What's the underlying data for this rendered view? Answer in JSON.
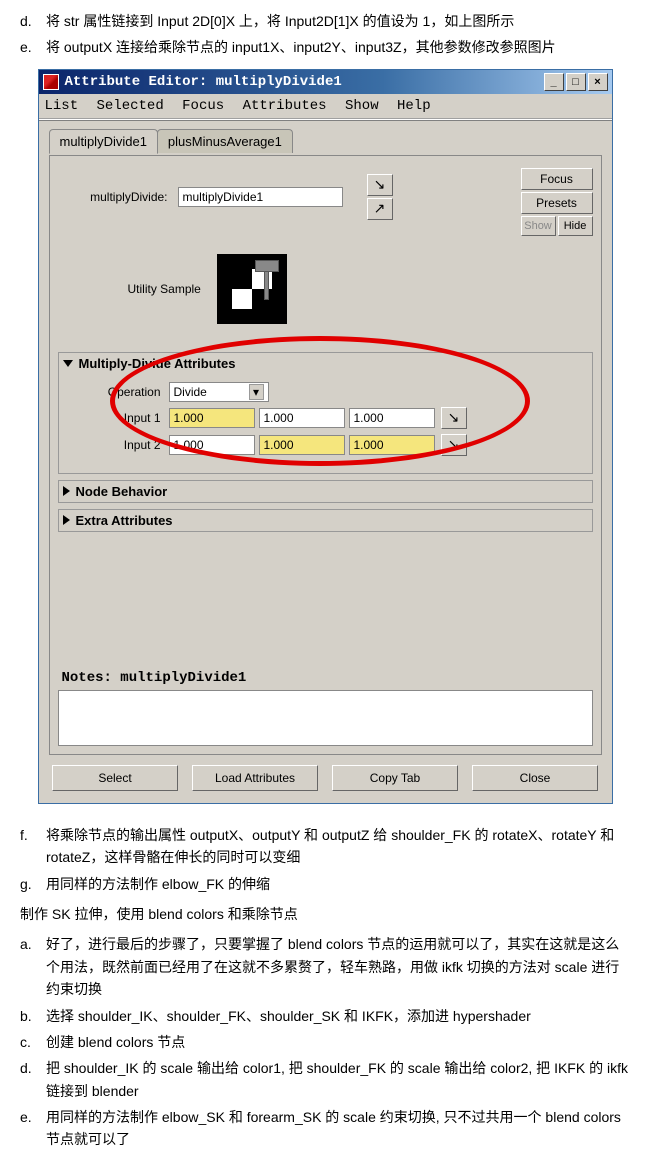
{
  "doc": {
    "d": {
      "bullet": "d.",
      "text": "将 str 属性链接到 Input 2D[0]X 上，将 Input2D[1]X 的值设为 1，如上图所示"
    },
    "e": {
      "bullet": "e.",
      "text": "将 outputX 连接给乘除节点的 input1X、input2Y、input3Z，其他参数修改参照图片"
    },
    "f": {
      "bullet": "f.",
      "text": "将乘除节点的输出属性 outputX、outputY 和 outputZ 给 shoulder_FK 的 rotateX、rotateY 和 rotateZ，这样骨骼在伸长的同时可以变细"
    },
    "g": {
      "bullet": "g.",
      "text": "用同样的方法制作 elbow_FK 的伸缩"
    },
    "section": "制作 SK 拉伸，使用 blend colors 和乘除节点",
    "a2": {
      "bullet": "a.",
      "text": "好了，进行最后的步骤了，只要掌握了 blend colors 节点的运用就可以了，其实在这就是这么个用法，既然前面已经用了在这就不多累赘了，轻车熟路，用做 ikfk 切换的方法对 scale 进行约束切换"
    },
    "b2": {
      "bullet": "b.",
      "text": "选择 shoulder_IK、shoulder_FK、shoulder_SK 和 IKFK，添加进 hypershader"
    },
    "c2": {
      "bullet": "c.",
      "text": "创建 blend colors 节点"
    },
    "d2": {
      "bullet": "d.",
      "text": "把 shoulder_IK 的 scale 输出给 color1, 把 shoulder_FK 的 scale 输出给 color2, 把 IKFK 的 ikfk 链接到 blender"
    },
    "e2": {
      "bullet": "e.",
      "text": "用同样的方法制作 elbow_SK 和 forearm_SK 的 scale 约束切换, 只不过共用一个 blend colors 节点就可以了"
    }
  },
  "window": {
    "title": "Attribute Editor: multiplyDivide1",
    "menu": [
      "List",
      "Selected",
      "Focus",
      "Attributes",
      "Show",
      "Help"
    ],
    "win_controls": {
      "min": "_",
      "max": "□",
      "close": "×"
    },
    "tabs": [
      {
        "label": "multiplyDivide1",
        "active": true
      },
      {
        "label": "plusMinusAverage1",
        "active": false
      }
    ],
    "name_label": "multiplyDivide:",
    "name_value": "multiplyDivide1",
    "side_buttons": {
      "focus": "Focus",
      "presets": "Presets",
      "show": "Show",
      "hide": "Hide"
    },
    "sample_label": "Utility Sample",
    "sections": {
      "attrs": {
        "title": "Multiply-Divide Attributes",
        "operation_label": "Operation",
        "operation_value": "Divide",
        "input1_label": "Input 1",
        "input1": [
          "1.000",
          "1.000",
          "1.000"
        ],
        "input2_label": "Input 2",
        "input2": [
          "1.000",
          "1.000",
          "1.000"
        ]
      },
      "node_behavior": "Node Behavior",
      "extra": "Extra Attributes"
    },
    "notes_label": "Notes: multiplyDivide1",
    "bottom": [
      "Select",
      "Load Attributes",
      "Copy Tab",
      "Close"
    ]
  }
}
